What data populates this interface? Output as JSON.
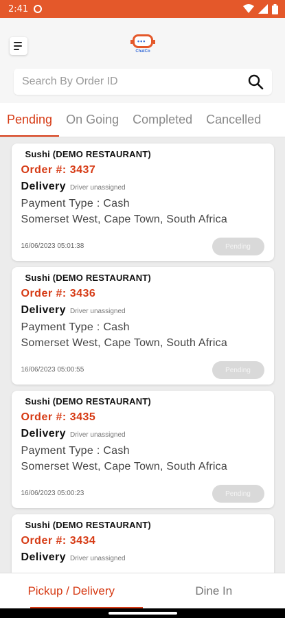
{
  "status_bar": {
    "time": "2:41"
  },
  "logo": {
    "name": "ChatCo"
  },
  "search": {
    "placeholder": "Search By Order ID"
  },
  "tabs": [
    {
      "label": "Pending",
      "active": true
    },
    {
      "label": "On Going",
      "active": false
    },
    {
      "label": "Completed",
      "active": false
    },
    {
      "label": "Cancelled",
      "active": false
    }
  ],
  "orders": [
    {
      "restaurant": "Sushi (DEMO RESTAURANT)",
      "order": "Order #: 3437",
      "mode": "Delivery",
      "driver": "Driver unassigned",
      "payment": "Payment Type : Cash",
      "address": "Somerset West, Cape Town, South Africa",
      "date": "16/06/2023 05:01:38",
      "status": "Pending"
    },
    {
      "restaurant": "Sushi (DEMO RESTAURANT)",
      "order": "Order #: 3436",
      "mode": "Delivery",
      "driver": "Driver unassigned",
      "payment": "Payment Type : Cash",
      "address": "Somerset West, Cape Town, South Africa",
      "date": "16/06/2023 05:00:55",
      "status": "Pending"
    },
    {
      "restaurant": "Sushi (DEMO RESTAURANT)",
      "order": "Order #: 3435",
      "mode": "Delivery",
      "driver": "Driver unassigned",
      "payment": "Payment Type : Cash",
      "address": "Somerset West, Cape Town, South Africa",
      "date": "16/06/2023 05:00:23",
      "status": "Pending"
    },
    {
      "restaurant": "Sushi (DEMO RESTAURANT)",
      "order": "Order #: 3434",
      "mode": "Delivery",
      "driver": "Driver unassigned",
      "payment": "",
      "address": "",
      "date": "",
      "status": ""
    }
  ],
  "bottom_nav": [
    {
      "label": "Pickup / Delivery",
      "active": true
    },
    {
      "label": "Dine In",
      "active": false
    }
  ],
  "colors": {
    "accent": "#e4582a",
    "order_red": "#d63a14",
    "pill_bg": "#d9d9d9"
  },
  "icons": {
    "menu": "hamburger-icon",
    "search": "search-icon",
    "settings": "gear-icon",
    "wifi": "wifi-icon",
    "signal": "signal-icon",
    "battery": "battery-icon"
  }
}
